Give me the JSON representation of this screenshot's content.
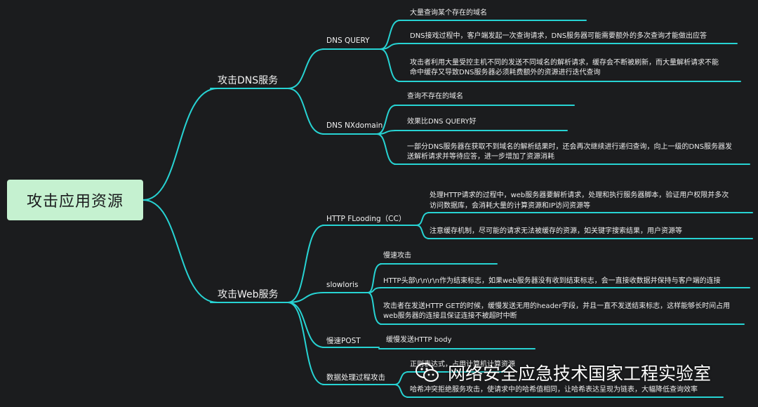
{
  "root": "攻击应用资源",
  "branches": [
    {
      "label": "攻击DNS服务",
      "children": [
        {
          "label": "DNS QUERY",
          "items": [
            [
              "大量查询某个存在的域名"
            ],
            [
              "DNS接戏过程中，客户端发起一次查询请求，DNS服务器可能需要额外的多次查询才能做出应答"
            ],
            [
              "攻击者利用大量受控主机不同的发送不同域名的解析请求，缓存会不断被刷新，而大量解析请求不能",
              "命中缓存又导致DNS服务器必须耗费额外的资源进行迭代查询"
            ]
          ]
        },
        {
          "label": "DNS NXdomain",
          "items": [
            [
              "查询不存在的域名"
            ],
            [
              "效果比DNS QUERY好"
            ],
            [
              "一部分DNS服务器在获取不到域名的解析结果时，还会再次继续进行递归查询，向上一级的DNS服务器发",
              "送解析请求并等待应答，进一步增加了资源消耗"
            ]
          ]
        }
      ]
    },
    {
      "label": "攻击Web服务",
      "children": [
        {
          "label": "HTTP FLooding（CC）",
          "items": [
            [
              "处理HTTP请求的过程中，web服务器要解析请求，处理和执行服务器脚本，验证用户权限并多次",
              "访问数据库，会消耗大量的计算资源和IP访问资源等"
            ],
            [
              "注意缓存机制，尽可能的请求无法被缓存的资源，如关键字搜索结果，用户资源等"
            ]
          ]
        },
        {
          "label": "slowloris",
          "items": [
            [
              "慢速攻击"
            ],
            [
              "HTTP头部\\r\\n\\r\\n作为结束标志，如果web服务器没有收到结束标志，会一直接收数据并保持与客户端的连接"
            ],
            [
              "攻击者在发送HTTP GET的时候，缓慢发送无用的header字段，并且一直不发送结束标志，这样能够长时间占用",
              "web服务器的连接且保证连接不被超时中断"
            ]
          ]
        },
        {
          "label": "慢速POST",
          "items": [
            [
              "缓慢发送HTTP body"
            ]
          ]
        },
        {
          "label": "数据处理过程攻击",
          "items": [
            [
              "正则表达式，占用计算机计算资源"
            ],
            [
              "哈希冲突拒绝服务攻击，使请求中的哈希值相同，让哈希表达呈现为链表，大幅降低查询效率"
            ]
          ]
        }
      ]
    }
  ],
  "watermark": "网络安全应急技术国家工程实验室",
  "colors": {
    "edge": "#27d3d3",
    "background": "#1b1c1e",
    "root_fill": "#c5f1d0"
  }
}
